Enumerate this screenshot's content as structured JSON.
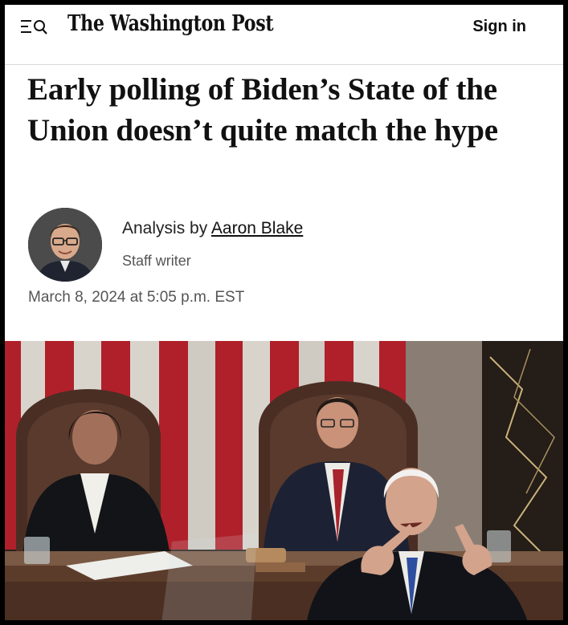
{
  "header": {
    "logo_text": "The Washington Post",
    "sign_in_label": "Sign in",
    "menu_icon": "menu-search-icon"
  },
  "article": {
    "headline": "Early polling of Biden’s State of the Union doesn’t quite match the hype",
    "byline_prefix": "Analysis by",
    "author": "Aaron Blake",
    "author_role": "Staff writer",
    "published": "March 8, 2024 at 5:05 p.m. EST"
  },
  "photo": {
    "icon": "lead-photo"
  },
  "colors": {
    "flag_red": "#b0202a",
    "flag_white": "#d8d4cc",
    "chair_brown": "#4a2e24",
    "suit_navy": "#1c2233"
  }
}
